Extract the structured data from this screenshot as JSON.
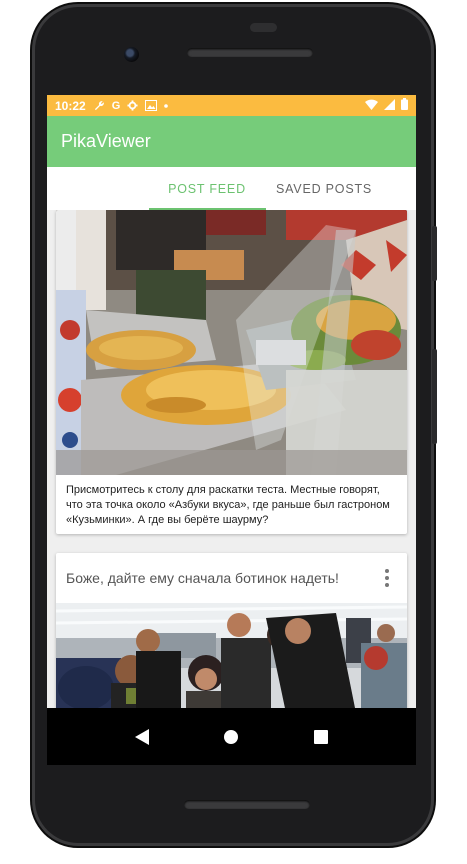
{
  "status_bar": {
    "time": "10:22",
    "icons": [
      "wrench-icon",
      "google-icon",
      "gear-icon",
      "image-icon",
      "dot-icon"
    ],
    "right_icons": [
      "wifi-icon",
      "signal-icon",
      "battery-icon"
    ],
    "color": "#fbbb40"
  },
  "app_bar": {
    "title": "PikaViewer",
    "color": "#76cc7a"
  },
  "tabs": [
    {
      "label": "POST FEED",
      "active": true
    },
    {
      "label": "SAVED POSTS",
      "active": false
    }
  ],
  "accent_color": "#6cc270",
  "feed": {
    "posts": [
      {
        "image": "food-counter-photo",
        "caption": "Присмотритесь к столу для раскатки теста. Местные говорят, что эта точка около «Азбуки вкуса», где раньше был гастроном «Кузьминки».  А где вы берёте шаурму?"
      },
      {
        "title": "Боже, дайте ему сначала ботинок надеть!",
        "image": "airport-security-photo"
      }
    ]
  },
  "nav_bar": {
    "buttons": [
      "back-icon",
      "home-icon",
      "recents-icon"
    ]
  }
}
